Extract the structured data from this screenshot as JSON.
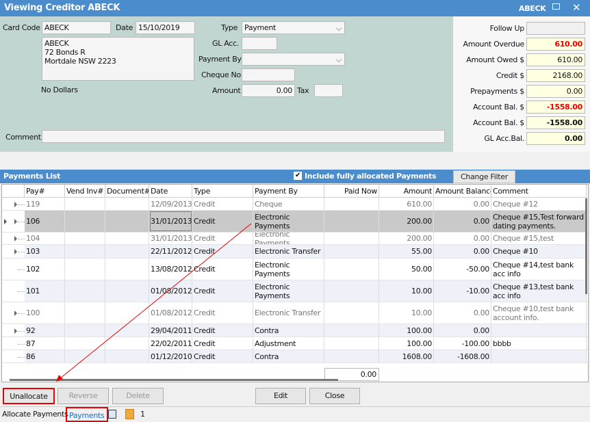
{
  "window": {
    "title": "Viewing Creditor ABECK",
    "code": "ABECK",
    "restore_icon": "restore-icon",
    "close_icon": "close-icon"
  },
  "form": {
    "card_code_label": "Card Code",
    "card_code": "ABECK",
    "date_label": "Date",
    "date": "15/10/2019",
    "address": [
      "ABECK",
      "72 Bonds R",
      "Mortdale NSW 2223"
    ],
    "no_dollars": "No Dollars",
    "type_label": "Type",
    "type": "Payment",
    "gl_acc_label": "GL Acc.",
    "gl_acc": "",
    "payment_by_label": "Payment By",
    "payment_by": "",
    "cheque_no_label": "Cheque No",
    "cheque_no": "",
    "amount_label": "Amount",
    "amount": "0.00",
    "tax_label": "Tax",
    "tax": "",
    "comment_label": "Comment",
    "comment": ""
  },
  "summary": {
    "follow_up_label": "Follow Up",
    "follow_up": "",
    "amount_overdue_label": "Amount Overdue",
    "amount_overdue": "610.00",
    "amount_owed_label": "Amount Owed $",
    "amount_owed": "610.00",
    "credit_label": "Credit $",
    "credit": "2168.00",
    "prepayments_label": "Prepayments $",
    "prepayments": "0.00",
    "account_bal_label": "Account Bal. $",
    "account_bal": "-1558.00",
    "account_bal2_label": "Account Bal. $",
    "account_bal2": "-1558.00",
    "gl_acc_bal_label": "GL Acc.Bal.",
    "gl_acc_bal": "0.00"
  },
  "payments_list": {
    "title": "Payments List",
    "include_label": "Include fully allocated Payments",
    "include_checked": true,
    "change_filter": "Change Filter",
    "columns": [
      "Pay#",
      "Vend Inv#",
      "Document#",
      "Date",
      "Type",
      "Payment By",
      "Paid Now",
      "Amount",
      "Amount Balance",
      "Comment"
    ],
    "rows": [
      {
        "pay": "119",
        "vend": "",
        "doc": "",
        "date": "12/09/2013",
        "type": "Credit",
        "by": "Cheque",
        "paid": "",
        "amount": "610.00",
        "balance": "0.00",
        "comment": "Cheque #12",
        "allocated": true,
        "expandable": true
      },
      {
        "pay": "106",
        "vend": "",
        "doc": "",
        "date": "31/01/2013",
        "type": "Credit",
        "by": "Electronic Payments",
        "paid": "",
        "amount": "200.00",
        "balance": "0.00",
        "comment": "Cheque #15,Test forward dating payments.",
        "allocated": false,
        "expandable": true,
        "selected": true
      },
      {
        "pay": "104",
        "vend": "",
        "doc": "",
        "date": "31/01/2013",
        "type": "Credit",
        "by": "Electronic Payments",
        "paid": "",
        "amount": "200.00",
        "balance": "0.00",
        "comment": "Cheque #15,test",
        "allocated": true,
        "expandable": true
      },
      {
        "pay": "103",
        "vend": "",
        "doc": "",
        "date": "22/11/2012",
        "type": "Credit",
        "by": "Electronic Transfer",
        "paid": "",
        "amount": "55.00",
        "balance": "0.00",
        "comment": "Cheque #10",
        "allocated": false,
        "expandable": true
      },
      {
        "pay": "102",
        "vend": "",
        "doc": "",
        "date": "13/08/2012",
        "type": "Credit",
        "by": "Electronic Payments",
        "paid": "",
        "amount": "50.00",
        "balance": "-50.00",
        "comment": "Cheque #14,test bank acc info",
        "allocated": false,
        "expandable": false
      },
      {
        "pay": "101",
        "vend": "",
        "doc": "",
        "date": "01/08/2012",
        "type": "Credit",
        "by": "Electronic Payments",
        "paid": "",
        "amount": "10.00",
        "balance": "-10.00",
        "comment": "Cheque #13,test bank acc info",
        "allocated": false,
        "expandable": false
      },
      {
        "pay": "100",
        "vend": "",
        "doc": "",
        "date": "01/08/2012",
        "type": "Credit",
        "by": "Electronic Transfer",
        "paid": "",
        "amount": "10.00",
        "balance": "0.00",
        "comment": "Cheque #10,test bank account info.",
        "allocated": true,
        "expandable": true
      },
      {
        "pay": "92",
        "vend": "",
        "doc": "",
        "date": "29/04/2011",
        "type": "Credit",
        "by": "Contra",
        "paid": "",
        "amount": "100.00",
        "balance": "0.00",
        "comment": "",
        "allocated": false,
        "expandable": true
      },
      {
        "pay": "87",
        "vend": "",
        "doc": "",
        "date": "22/02/2011",
        "type": "Credit",
        "by": "Adjustment",
        "paid": "",
        "amount": "100.00",
        "balance": "-100.00",
        "comment": "bbbb",
        "allocated": false,
        "expandable": false
      },
      {
        "pay": "86",
        "vend": "",
        "doc": "",
        "date": "01/12/2010",
        "type": "Credit",
        "by": "Contra",
        "paid": "",
        "amount": "1608.00",
        "balance": "-1608.00",
        "comment": "",
        "allocated": false,
        "expandable": false
      }
    ],
    "paid_now_total": "0.00"
  },
  "buttons": {
    "unallocate": "Unallocate",
    "reverse": "Reverse",
    "delete": "Delete",
    "edit": "Edit",
    "close": "Close"
  },
  "status_bar": {
    "allocate_payments": "Allocate Payments",
    "payments": "Payments",
    "docs_count": "1"
  },
  "colors": {
    "title_bar": "#4a8ccc",
    "form_bg": "#c1d6d1",
    "highlight": "#ff0000",
    "overdue": "#e00000",
    "field_yellow": "#ffffe1"
  }
}
